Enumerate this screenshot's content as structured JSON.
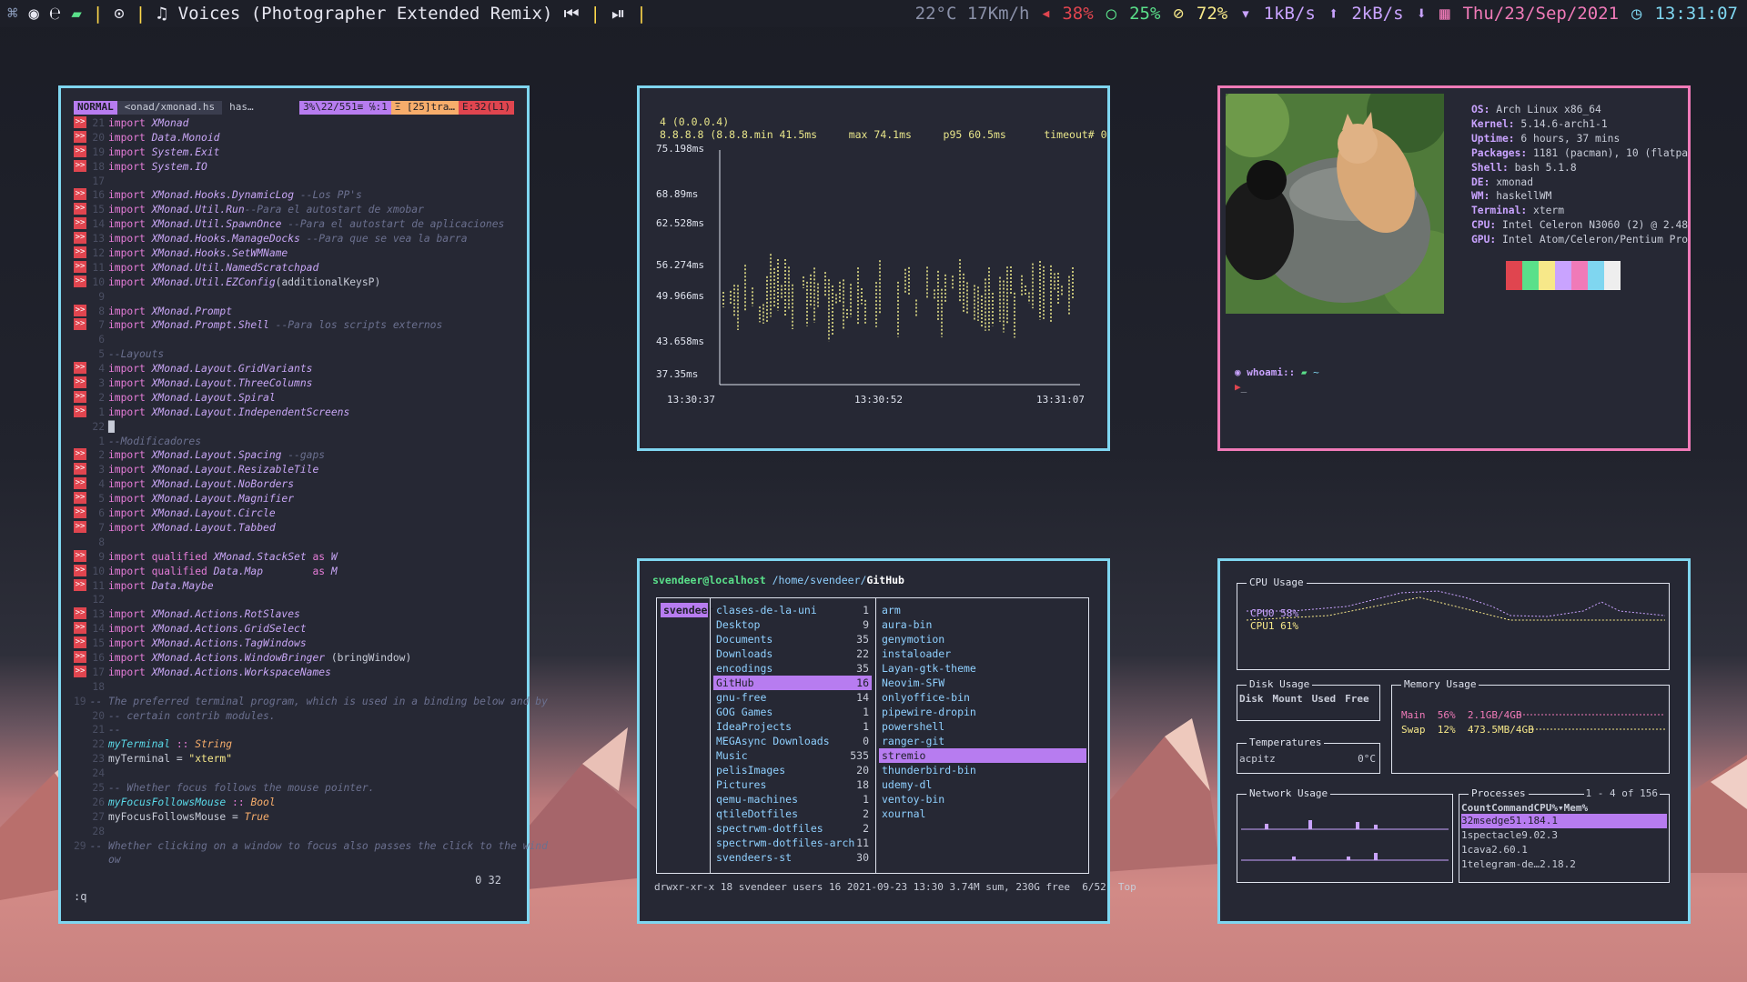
{
  "colors": {
    "accent_blue": "#7fd6f0",
    "accent_pink": "#f07ab8",
    "purple": "#b77cf0"
  },
  "topbar": {
    "icons": [
      "shell-icon",
      "chrome-icon",
      "emacs-icon",
      "files-icon",
      "vlc-icon"
    ],
    "now_playing": "Voices (Photographer Extended Remix)",
    "weather": "22°C 17Km/h",
    "volume": "38%",
    "cpu": "25%",
    "mem": "72%",
    "net_down": "1kB/s",
    "net_up": "2kB/s",
    "date": "Thu/23/Sep/2021",
    "time": "13:31:07"
  },
  "vim": {
    "mode": "NORMAL",
    "file": "<onad/xmonad.hs",
    "fmt": "has…",
    "pos": "3%\\22/551≡ ℅:1",
    "trail": "Ξ [25]tra…",
    "err": "E:32(L1)",
    "lines": [
      {
        "s": 1,
        "n": "21",
        "t": [
          [
            "kw",
            "import "
          ],
          [
            "mod",
            "XMonad"
          ]
        ]
      },
      {
        "s": 1,
        "n": "20",
        "t": [
          [
            "kw",
            "import "
          ],
          [
            "mod",
            "Data.Monoid"
          ]
        ]
      },
      {
        "s": 1,
        "n": "19",
        "t": [
          [
            "kw",
            "import "
          ],
          [
            "mod",
            "System.Exit"
          ]
        ]
      },
      {
        "s": 1,
        "n": "18",
        "t": [
          [
            "kw",
            "import "
          ],
          [
            "mod",
            "System.IO"
          ]
        ]
      },
      {
        "s": 0,
        "n": "17",
        "t": []
      },
      {
        "s": 1,
        "n": "16",
        "t": [
          [
            "kw",
            "import "
          ],
          [
            "mod",
            "XMonad.Hooks.DynamicLog "
          ],
          [
            "cm",
            "--Los PP's"
          ]
        ]
      },
      {
        "s": 1,
        "n": "15",
        "t": [
          [
            "kw",
            "import "
          ],
          [
            "mod",
            "XMonad.Util.Run"
          ],
          [
            "cm",
            "--Para el autostart de xmobar"
          ]
        ]
      },
      {
        "s": 1,
        "n": "14",
        "t": [
          [
            "kw",
            "import "
          ],
          [
            "mod",
            "XMonad.Util.SpawnOnce "
          ],
          [
            "cm",
            "--Para el autostart de aplicaciones"
          ]
        ]
      },
      {
        "s": 1,
        "n": "13",
        "t": [
          [
            "kw",
            "import "
          ],
          [
            "mod",
            "XMonad.Hooks.ManageDocks "
          ],
          [
            "cm",
            "--Para que se vea la barra"
          ]
        ]
      },
      {
        "s": 1,
        "n": "12",
        "t": [
          [
            "kw",
            "import "
          ],
          [
            "mod",
            "XMonad.Hooks.SetWMName"
          ]
        ]
      },
      {
        "s": 1,
        "n": "11",
        "t": [
          [
            "kw",
            "import "
          ],
          [
            "mod",
            "XMonad.Util.NamedScratchpad"
          ]
        ]
      },
      {
        "s": 1,
        "n": "10",
        "t": [
          [
            "kw",
            "import "
          ],
          [
            "mod",
            "XMonad.Util.EZConfig"
          ],
          [
            "",
            "(additionalKeysP)"
          ]
        ]
      },
      {
        "s": 0,
        "n": "9",
        "t": []
      },
      {
        "s": 1,
        "n": "8",
        "t": [
          [
            "kw",
            "import "
          ],
          [
            "mod",
            "XMonad.Prompt"
          ]
        ]
      },
      {
        "s": 1,
        "n": "7",
        "t": [
          [
            "kw",
            "import "
          ],
          [
            "mod",
            "XMonad.Prompt.Shell "
          ],
          [
            "cm",
            "--Para los scripts externos"
          ]
        ]
      },
      {
        "s": 0,
        "n": "6",
        "t": []
      },
      {
        "s": 0,
        "n": "5",
        "t": [
          [
            "cm",
            "--Layouts"
          ]
        ]
      },
      {
        "s": 1,
        "n": "4",
        "t": [
          [
            "kw",
            "import "
          ],
          [
            "mod",
            "XMonad.Layout.GridVariants"
          ]
        ]
      },
      {
        "s": 1,
        "n": "3",
        "t": [
          [
            "kw",
            "import "
          ],
          [
            "mod",
            "XMonad.Layout.ThreeColumns"
          ]
        ]
      },
      {
        "s": 1,
        "n": "2",
        "t": [
          [
            "kw",
            "import "
          ],
          [
            "mod",
            "XMonad.Layout.Spiral"
          ]
        ]
      },
      {
        "s": 1,
        "n": "1",
        "t": [
          [
            "kw",
            "import "
          ],
          [
            "mod",
            "XMonad.Layout.IndependentScreens"
          ]
        ]
      },
      {
        "s": 0,
        "n": "22",
        "t": [
          [
            "",
            "█"
          ]
        ],
        "cur": 1
      },
      {
        "s": 0,
        "n": "1",
        "t": [
          [
            "cm",
            "--Modificadores"
          ]
        ]
      },
      {
        "s": 1,
        "n": "2",
        "t": [
          [
            "kw",
            "import "
          ],
          [
            "mod",
            "XMonad.Layout.Spacing "
          ],
          [
            "cm",
            "--gaps"
          ]
        ]
      },
      {
        "s": 1,
        "n": "3",
        "t": [
          [
            "kw",
            "import "
          ],
          [
            "mod",
            "XMonad.Layout.ResizableTile"
          ]
        ]
      },
      {
        "s": 1,
        "n": "4",
        "t": [
          [
            "kw",
            "import "
          ],
          [
            "mod",
            "XMonad.Layout.NoBorders"
          ]
        ]
      },
      {
        "s": 1,
        "n": "5",
        "t": [
          [
            "kw",
            "import "
          ],
          [
            "mod",
            "XMonad.Layout.Magnifier"
          ]
        ]
      },
      {
        "s": 1,
        "n": "6",
        "t": [
          [
            "kw",
            "import "
          ],
          [
            "mod",
            "XMonad.Layout.Circle"
          ]
        ]
      },
      {
        "s": 1,
        "n": "7",
        "t": [
          [
            "kw",
            "import "
          ],
          [
            "mod",
            "XMonad.Layout.Tabbed"
          ]
        ]
      },
      {
        "s": 0,
        "n": "8",
        "t": []
      },
      {
        "s": 1,
        "n": "9",
        "t": [
          [
            "kw",
            "import qualified "
          ],
          [
            "mod",
            "XMonad.StackSet "
          ],
          [
            "kw",
            "as "
          ],
          [
            "mod",
            "W"
          ]
        ]
      },
      {
        "s": 1,
        "n": "10",
        "t": [
          [
            "kw",
            "import qualified "
          ],
          [
            "mod",
            "Data.Map        "
          ],
          [
            "kw",
            "as "
          ],
          [
            "mod",
            "M"
          ]
        ]
      },
      {
        "s": 1,
        "n": "11",
        "t": [
          [
            "kw",
            "import "
          ],
          [
            "mod",
            "Data.Maybe"
          ]
        ]
      },
      {
        "s": 0,
        "n": "12",
        "t": []
      },
      {
        "s": 1,
        "n": "13",
        "t": [
          [
            "kw",
            "import "
          ],
          [
            "mod",
            "XMonad.Actions.RotSlaves"
          ]
        ]
      },
      {
        "s": 1,
        "n": "14",
        "t": [
          [
            "kw",
            "import "
          ],
          [
            "mod",
            "XMonad.Actions.GridSelect"
          ]
        ]
      },
      {
        "s": 1,
        "n": "15",
        "t": [
          [
            "kw",
            "import "
          ],
          [
            "mod",
            "XMonad.Actions.TagWindows"
          ]
        ]
      },
      {
        "s": 1,
        "n": "16",
        "t": [
          [
            "kw",
            "import "
          ],
          [
            "mod",
            "XMonad.Actions.WindowBringer "
          ],
          [
            "",
            "(bringWindow)"
          ]
        ]
      },
      {
        "s": 1,
        "n": "17",
        "t": [
          [
            "kw",
            "import "
          ],
          [
            "mod",
            "XMonad.Actions.WorkspaceNames"
          ]
        ]
      },
      {
        "s": 0,
        "n": "18",
        "t": []
      },
      {
        "s": 0,
        "n": "19",
        "t": [
          [
            "cm",
            "-- The preferred terminal program, which is used in a binding below and by"
          ]
        ]
      },
      {
        "s": 0,
        "n": "20",
        "t": [
          [
            "cm",
            "-- certain contrib modules."
          ]
        ]
      },
      {
        "s": 0,
        "n": "21",
        "t": [
          [
            "cm",
            "--"
          ]
        ]
      },
      {
        "s": 0,
        "n": "22",
        "t": [
          [
            "ty",
            "myTerminal "
          ],
          [
            "kw",
            ":: "
          ],
          [
            "tr",
            "String"
          ]
        ]
      },
      {
        "s": 0,
        "n": "23",
        "t": [
          [
            "",
            "myTerminal = "
          ],
          [
            "str",
            "\"xterm\""
          ]
        ]
      },
      {
        "s": 0,
        "n": "24",
        "t": []
      },
      {
        "s": 0,
        "n": "25",
        "t": [
          [
            "cm",
            "-- Whether focus follows the mouse pointer."
          ]
        ]
      },
      {
        "s": 0,
        "n": "26",
        "t": [
          [
            "ty",
            "myFocusFollowsMouse "
          ],
          [
            "kw",
            ":: "
          ],
          [
            "tr",
            "Bool"
          ]
        ]
      },
      {
        "s": 0,
        "n": "27",
        "t": [
          [
            "",
            "myFocusFollowsMouse = "
          ],
          [
            "tr",
            "True"
          ]
        ]
      },
      {
        "s": 0,
        "n": "28",
        "t": []
      },
      {
        "s": 0,
        "n": "29",
        "t": [
          [
            "cm",
            "-- Whether clicking on a window to focus also passes the click to the wind"
          ]
        ]
      },
      {
        "s": 0,
        "n": "",
        "t": [
          [
            "cm",
            "ow"
          ]
        ]
      }
    ],
    "ruler": "0  32",
    "cmd": ":q"
  },
  "ping": {
    "header": "4 (0.0.0.4)",
    "stats": "8.8.8.8 (8.8.8.min 41.5ms     max 74.1ms     p95 60.5ms      timeout# 0",
    "yticks": [
      "75.198ms",
      "68.89ms",
      "62.528ms",
      "56.274ms",
      "49.966ms",
      "43.658ms",
      "37.35ms"
    ],
    "xticks": [
      "13:30:37",
      "13:30:52",
      "13:31:07"
    ]
  },
  "neofetch": {
    "lines": [
      [
        "OS:",
        "Arch Linux x86_64"
      ],
      [
        "Kernel:",
        "5.14.6-arch1-1"
      ],
      [
        "Uptime:",
        "6 hours, 37 mins"
      ],
      [
        "Packages:",
        "1181 (pacman), 10 (flatpa"
      ],
      [
        "Shell:",
        "bash 5.1.8"
      ],
      [
        "DE:",
        "xmonad"
      ],
      [
        "WM:",
        "haskellWM"
      ],
      [
        "Terminal:",
        "xterm"
      ],
      [
        "CPU:",
        "Intel Celeron N3060 (2) @ 2.48"
      ],
      [
        "GPU:",
        "Intel Atom/Celeron/Pentium Pro"
      ]
    ],
    "palette": [
      "#262834",
      "#e0454f",
      "#5ae08a",
      "#f7e889",
      "#c9a3ff",
      "#f07ab8",
      "#7fd6f0",
      "#eeeeee"
    ],
    "prompt_user": "whoami::",
    "prompt_dir": "~",
    "cursor": "_"
  },
  "ranger": {
    "user": "svendeer@localhost",
    "path": "/home/svendeer/",
    "cwd": "GitHub",
    "parent": "svendeer",
    "dirs": [
      [
        "clases-de-la-uni",
        "1"
      ],
      [
        "Desktop",
        "9"
      ],
      [
        "Documents",
        "35"
      ],
      [
        "Downloads",
        "22"
      ],
      [
        "encodings",
        "35"
      ],
      [
        "GitHub",
        "16"
      ],
      [
        "gnu-free",
        "14"
      ],
      [
        "GOG Games",
        "1"
      ],
      [
        "IdeaProjects",
        "1"
      ],
      [
        "MEGAsync Downloads",
        "0"
      ],
      [
        "Music",
        "535"
      ],
      [
        "pelisImages",
        "20"
      ],
      [
        "Pictures",
        "18"
      ],
      [
        "qemu-machines",
        "1"
      ],
      [
        "qtileDotfiles",
        "2"
      ],
      [
        "spectrwm-dotfiles",
        "2"
      ],
      [
        "spectrwm-dotfiles-arch",
        "11"
      ],
      [
        "svendeers-st",
        "30"
      ]
    ],
    "sel": 5,
    "preview": [
      "arm",
      "aura-bin",
      "genymotion",
      "instaloader",
      "Layan-gtk-theme",
      "Neovim-SFW",
      "onlyoffice-bin",
      "pipewire-dropin",
      "powershell",
      "ranger-git",
      "stremio",
      "thunderbird-bin",
      "udemy-dl",
      "ventoy-bin",
      "xournal"
    ],
    "psel": 10,
    "status": "drwxr-xr-x 18 svendeer users 16 2021-09-23 13:30 3.74M sum, 230G free  6/52  Top"
  },
  "gtop": {
    "cpu_title": "CPU Usage",
    "cpu0": "CPU0  58%",
    "cpu1": "CPU1  61%",
    "disk_title": "Disk Usage",
    "disk_cols": [
      "Disk",
      "Mount",
      "Used",
      "Free"
    ],
    "mem_title": "Memory Usage",
    "mem_main": "Main  56%  2.1GB/4GB",
    "mem_swap": "Swap  12%  473.5MB/4GB",
    "temp_title": "Temperatures",
    "temp_name": "acpitz",
    "temp_val": "0°C",
    "net_title": "Network Usage",
    "proc_title": "Processes",
    "proc_range": "1 - 4 of 156",
    "proc_cols": [
      "Count",
      "Command",
      "CPU%▾",
      "Mem%"
    ],
    "procs": [
      [
        "32",
        "msedge",
        "51.1",
        "84.1"
      ],
      [
        "1",
        "spectacle",
        "9.0",
        "2.3"
      ],
      [
        "1",
        "cava",
        "2.6",
        "0.1"
      ],
      [
        "1",
        "telegram-de…",
        "2.1",
        "8.2"
      ]
    ]
  }
}
